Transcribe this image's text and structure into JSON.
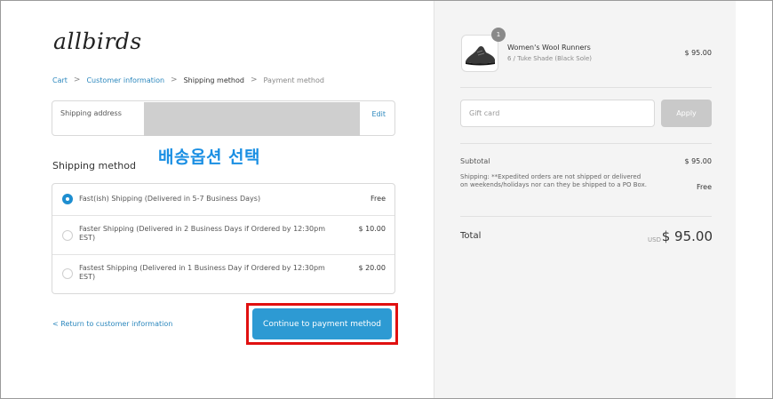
{
  "brand": {
    "logo_text": "allbirds"
  },
  "breadcrumb": {
    "items": [
      "Cart",
      "Customer information",
      "Shipping method",
      "Payment method"
    ],
    "separator": ">"
  },
  "shipping_address": {
    "label": "Shipping address",
    "edit_label": "Edit"
  },
  "shipping_method": {
    "title": "Shipping method",
    "annotation": "배송옵션 선택",
    "options": [
      {
        "label": "Fast(ish) Shipping (Delivered in 5-7 Business Days)",
        "price": "Free",
        "selected": true
      },
      {
        "label": "Faster Shipping (Delivered in 2 Business Days if Ordered by 12:30pm EST)",
        "price": "$ 10.00",
        "selected": false
      },
      {
        "label": "Fastest Shipping (Delivered in 1 Business Day if Ordered by 12:30pm EST)",
        "price": "$ 20.00",
        "selected": false
      }
    ]
  },
  "footer": {
    "return_link": "< Return to customer information",
    "continue_label": "Continue to payment method"
  },
  "order": {
    "item": {
      "quantity": "1",
      "name": "Women's Wool Runners",
      "variant": "6 / Tuke Shade (Black Sole)",
      "price": "$ 95.00",
      "image_icon": "shoe-icon"
    },
    "gift_card": {
      "placeholder": "Gift card",
      "apply_label": "Apply"
    },
    "subtotal_label": "Subtotal",
    "subtotal_value": "$ 95.00",
    "shipping_label": "Shipping: **Expedited orders are not shipped or delivered on weekends/holidays nor can they be shipped to a PO Box.",
    "shipping_value": "Free",
    "total_label": "Total",
    "total_currency": "USD",
    "total_value": "$ 95.00"
  },
  "colors": {
    "accent": "#2d9ad3",
    "link": "#2b87bd",
    "highlight_box": "#e01010",
    "annotation": "#1a8fe3",
    "sidebar_bg": "#f4f4f4"
  }
}
